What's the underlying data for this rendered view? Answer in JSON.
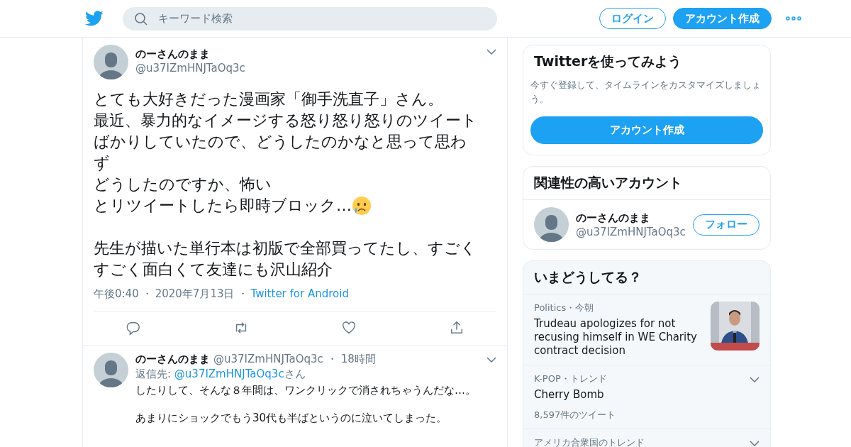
{
  "header": {
    "search": {
      "placeholder": "キーワード検索"
    },
    "login": "ログイン",
    "signup": "アカウント作成"
  },
  "tweet": {
    "name": "のーさんのまま",
    "handle": "@u37IZmHNJTaOq3c",
    "paragraphs": [
      [
        {
          "kind": "plain",
          "text": "とても大好きだった漫画家「御手洗直子」さん。"
        },
        {
          "kind": "plain",
          "text": "最近、暴力的なイメージする怒り怒り怒りのツイート"
        },
        {
          "kind": "plain",
          "text": "ばかりしていたので、どうしたのかなと思って思わ"
        },
        {
          "kind": "plain",
          "text": "ず"
        },
        {
          "kind": "plain",
          "text": "どうしたのですか、怖い"
        },
        {
          "kind": "crying-emoji",
          "text": "とリツイートしたら即時ブロック…"
        }
      ],
      [
        {
          "kind": "plain",
          "text": "先生が描いた単行本は初版で全部買ってたし、すごく"
        },
        {
          "kind": "plain",
          "text": "すごく面白くて友達にも沢山紹介"
        }
      ]
    ],
    "time": "午後0:40",
    "date": "2020年7月13日",
    "source": "Twitter for Android",
    "separator": "・"
  },
  "reply": {
    "name": "のーさんのまま",
    "handle": "@u37IZmHNJTaOq3c",
    "separator": "・",
    "age": "18時間",
    "reply_prefix": "返信先: ",
    "reply_to": "@u37IZmHNJTaOq3c",
    "reply_suffix": "さん",
    "paragraphs": [
      [
        "したりして、そんな８年間は、ワンクリックで消されちゃうんだな…。"
      ],
      [
        "あまりにショックでもう30代も半ばというのに泣いてしまった。"
      ]
    ]
  },
  "signup_card": {
    "title": "Twitterを使ってみよう",
    "text": "今すぐ登録して、タイムラインをカスタマイズしましょう。",
    "button": "アカウント作成"
  },
  "related": {
    "title": "関連性の高いアカウント",
    "accounts": [
      {
        "name": "のーさんのまま",
        "handle": "@u37IZmHNJTaOq3c",
        "button": "フォロー"
      }
    ]
  },
  "trends": {
    "title": "いまどうしてる？",
    "items": [
      {
        "kind": "news",
        "category": "Politics・今朝",
        "headline": "Trudeau apologizes for not recusing himself in WE Charity contract decision"
      },
      {
        "kind": "trend",
        "category": "K-POP・トレンド",
        "headline": "Cherry Bomb",
        "count": "8,597件のツイート"
      },
      {
        "kind": "heading",
        "category": "アメリカ合衆国のトレンド"
      }
    ]
  }
}
